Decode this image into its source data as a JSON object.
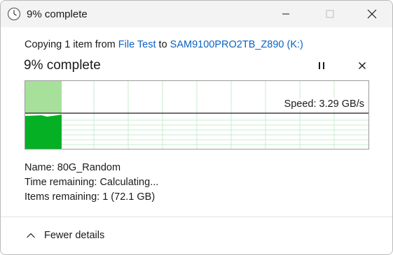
{
  "window": {
    "title": "9% complete"
  },
  "copy_info": {
    "prefix": "Copying 1 item from",
    "source": "File Test",
    "connector": "to",
    "destination": "SAM9100PRO2TB_Z890 (K:)"
  },
  "status": {
    "heading": "9% complete",
    "progress_fraction": 0.09
  },
  "graph": {
    "speed_label": "Speed: 3.29 GB/s",
    "colors": {
      "completed": "#06b025",
      "completed_light": "#a7e09a",
      "grid": "#c7ecd0",
      "speed_line": "#1a1a1a"
    }
  },
  "details": {
    "name_label": "Name:",
    "name_value": "80G_Random",
    "time_label": "Time remaining:",
    "time_value": "Calculating...",
    "items_label": "Items remaining:",
    "items_value": "1 (72.1 GB)"
  },
  "footer": {
    "toggle_label": "Fewer details"
  },
  "icons": {
    "app": "clock-icon",
    "minimize": "minimize-icon",
    "maximize": "maximize-icon",
    "close": "close-icon",
    "pause": "pause-icon",
    "cancel": "cancel-icon",
    "collapse": "chevron-up-icon"
  }
}
